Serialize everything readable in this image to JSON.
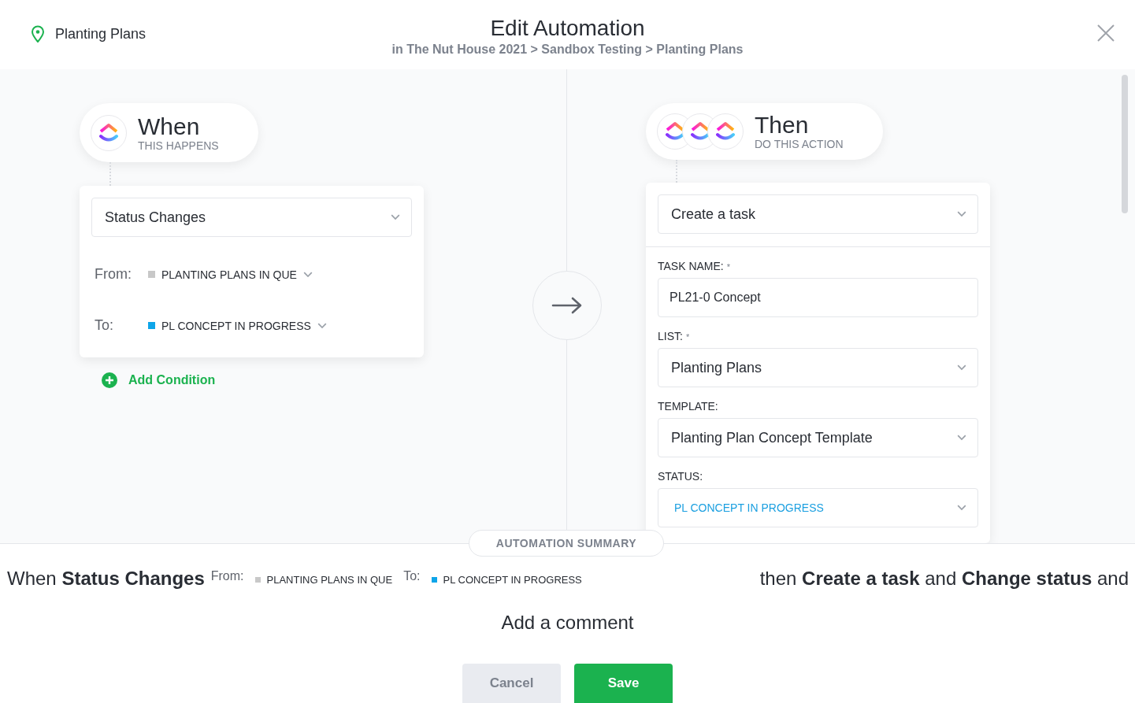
{
  "header": {
    "location": "Planting Plans",
    "title": "Edit Automation",
    "breadcrumb": "in The Nut House 2021 > Sandbox Testing > Planting Plans"
  },
  "trigger": {
    "title": "When",
    "subtitle": "THIS HAPPENS",
    "select": "Status Changes",
    "conditions": [
      {
        "label": "From:",
        "status": "PLANTING PLANS IN QUE",
        "color": "#c8c8c8"
      },
      {
        "label": "To:",
        "status": "PL CONCEPT IN PROGRESS",
        "color": "#0ea5e9"
      }
    ],
    "add_condition": "Add Condition"
  },
  "action": {
    "title": "Then",
    "subtitle": "DO THIS ACTION",
    "select": "Create a task",
    "fields": [
      {
        "kind": "input",
        "label": "TASK NAME:",
        "mark": "*",
        "value": "PL21-0 Concept"
      },
      {
        "kind": "select",
        "label": "LIST:",
        "mark": "*",
        "value": "Planting Plans"
      },
      {
        "kind": "select",
        "label": "TEMPLATE:",
        "value": "Planting Plan Concept Template"
      },
      {
        "kind": "status",
        "label": "STATUS:",
        "value": "PL CONCEPT IN PROGRESS",
        "color": "#1a9fe0"
      }
    ]
  },
  "summary": {
    "heading": "AUTOMATION SUMMARY",
    "lead": "When **Status Changes**",
    "conditions": [
      {
        "label": "From:",
        "status": "PLANTING PLANS IN QUE",
        "color": "#c8c8c8"
      },
      {
        "label": "To:",
        "status": "PL CONCEPT IN PROGRESS",
        "color": "#0ea5e9"
      }
    ],
    "tail": "then **Create a task** and **Change status** and",
    "next": "Add a comment"
  },
  "buttons": [
    {
      "kind": "secondary",
      "label": "Cancel"
    },
    {
      "kind": "primary",
      "label": "Save"
    }
  ]
}
